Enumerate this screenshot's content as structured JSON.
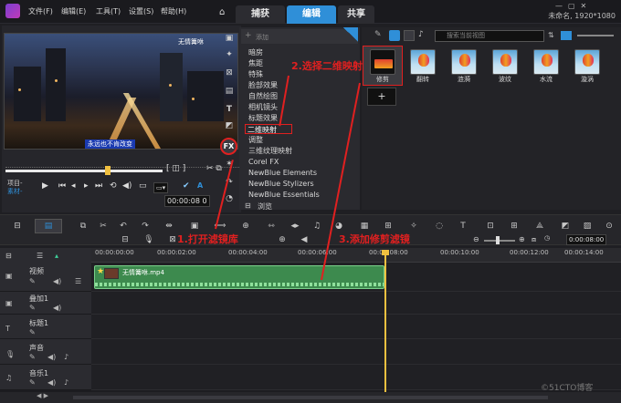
{
  "app": {
    "menus": [
      "文件(F)",
      "编辑(E)",
      "工具(T)",
      "设置(S)",
      "帮助(H)"
    ],
    "workspace_tabs": [
      "捕获",
      "编辑",
      "共享"
    ],
    "project_meta": "未命名, 1920*1080"
  },
  "preview": {
    "overlay_caption": "无情篝咻",
    "subtitle": "永远也不肯改变",
    "project_label": "项目-",
    "clip_label": "素材-",
    "timecode": "00:00:08 0"
  },
  "library": {
    "add_label": "添加",
    "items": [
      "暗房",
      "焦距",
      "特殊",
      "脸部效果",
      "自然绘图",
      "相机镜头",
      "标题效果",
      "二维映射",
      "调整",
      "三维纹理映射",
      "Corel FX",
      "NewBlue Elements",
      "NewBlue Stylizers",
      "NewBlue Essentials"
    ],
    "selected": "二维映射",
    "browse_label": "浏览"
  },
  "filters": {
    "search_placeholder": "搜索当前视图",
    "items": [
      "修剪",
      "翻转",
      "涟漪",
      "波纹",
      "水流",
      "漩涡"
    ]
  },
  "timeline": {
    "ruler": [
      "00:00:00:00",
      "00:00:02:00",
      "00:00:04:00",
      "00:00:06:00",
      "00:00:08:00",
      "00:00:10:00",
      "00:00:12:00",
      "00:00:14:00"
    ],
    "zoom_time": "0:00:08:00",
    "tracks": [
      "视频",
      "叠加1",
      "标题1",
      "声音",
      "音乐1"
    ],
    "clip_name": "无情篝咻.mp4"
  },
  "annotations": {
    "step1": "1.打开滤镜库",
    "step2": "2.选择二维映射",
    "step3": "3.添加修剪滤镜"
  },
  "watermark": "©51CTO博客",
  "colors": {
    "accent": "#2f8fd8",
    "annotation": "#e02020",
    "clip": "#3d8a4e"
  }
}
